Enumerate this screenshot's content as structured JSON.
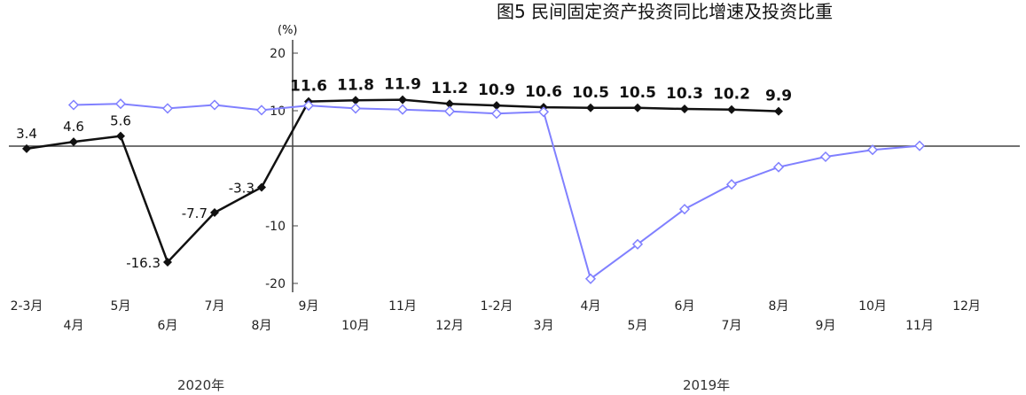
{
  "chart_data": {
    "type": "line",
    "title": "图5  民间固定资产投资同比增速及投资比重",
    "unit_label": "(%)",
    "ylim": [
      -20,
      20
    ],
    "yticks": [
      20,
      10,
      -10,
      -20
    ],
    "categories": [
      "2-3月",
      "4月",
      "5月",
      "6月",
      "7月",
      "8月",
      "9月",
      "10月",
      "11月",
      "12月",
      "1-2月",
      "3月",
      "4月",
      "5月",
      "6月",
      "7月",
      "8月",
      "9月",
      "10月",
      "11月",
      "12月"
    ],
    "year_labels": [
      "2020年",
      "2019年"
    ],
    "series": [
      {
        "name": "",
        "color": "#111111",
        "values": [
          3.4,
          4.6,
          5.6,
          -16.3,
          -7.7,
          -3.3,
          11.6,
          11.8,
          11.9,
          11.2,
          10.9,
          10.6,
          10.5,
          10.5,
          10.3,
          10.2,
          9.9,
          null,
          null,
          null,
          null
        ],
        "labels": [
          "3.4",
          "4.6",
          "5.6",
          "-16.3",
          "-7.7",
          "-3.3",
          "11.6",
          "11.8",
          "11.9",
          "11.2",
          "10.9",
          "10.6",
          "10.5",
          "10.5",
          "10.3",
          "10.2",
          "9.9",
          "",
          "",
          "",
          ""
        ]
      },
      {
        "name": "",
        "color": "#8080ff",
        "values": [
          null,
          11.0,
          11.2,
          10.4,
          11.0,
          10.1,
          10.9,
          10.4,
          10.2,
          9.9,
          9.5,
          9.8,
          -19.2,
          -13.2,
          -7.1,
          -2.8,
          0.2,
          2.0,
          3.2,
          3.9,
          null
        ],
        "labels": [
          "",
          "",
          "",
          "",
          "",
          "",
          "",
          "",
          "",
          "",
          "",
          "",
          "",
          "",
          "",
          "",
          "",
          "",
          "",
          "",
          ""
        ]
      }
    ]
  }
}
